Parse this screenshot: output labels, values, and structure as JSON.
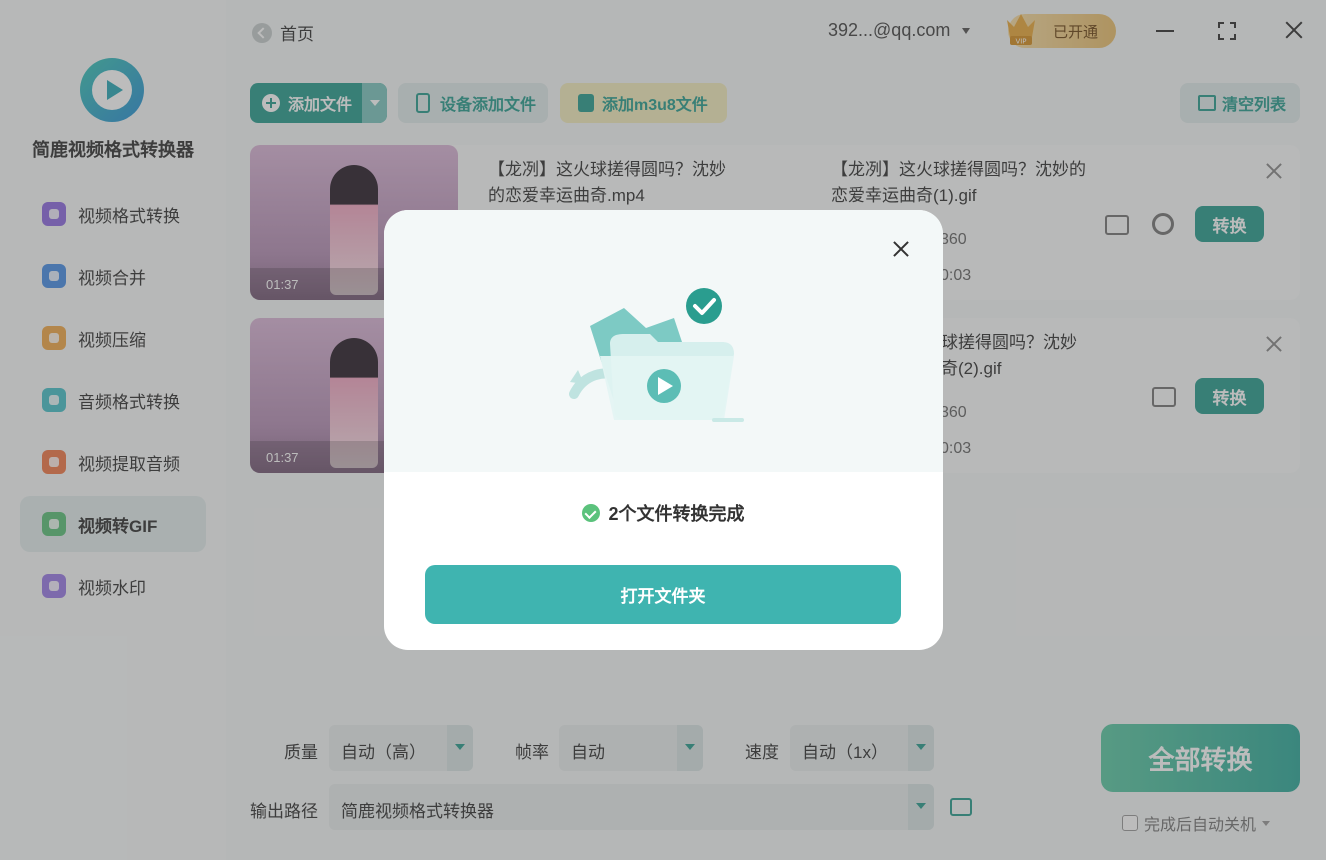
{
  "app": {
    "name": "简鹿视频格式转换器"
  },
  "sidebar": {
    "items": [
      {
        "label": "视频格式转换",
        "color": "#8e6be0"
      },
      {
        "label": "视频合并",
        "color": "#4a8fe6"
      },
      {
        "label": "视频压缩",
        "color": "#f0a94a"
      },
      {
        "label": "音频格式转换",
        "color": "#4ac0c8"
      },
      {
        "label": "视频提取音频",
        "color": "#f07a4a"
      },
      {
        "label": "视频转GIF",
        "color": "#5cc07a",
        "active": true
      },
      {
        "label": "视频水印",
        "color": "#9a7be6"
      }
    ]
  },
  "topbar": {
    "home": "首页",
    "account": "392...@qq.com",
    "vip_label": "已开通",
    "vip_badge": "VIP"
  },
  "toolbar": {
    "add_files": "添加文件",
    "device_add": "设备添加文件",
    "add_m3u8": "添加m3u8文件",
    "clear_list": "清空列表"
  },
  "files": [
    {
      "duration": "01:37",
      "source_name": "【龙冽】这火球搓得圆吗？沈妙的恋爱幸运曲奇.mp4",
      "output_name": "【龙冽】这火球搓得圆吗？沈妙的恋爱幸运曲奇(1).gif",
      "meta1": "360",
      "meta2": "0:03",
      "convert": "转换"
    },
    {
      "duration": "01:37",
      "output_name_partial_1": "球搓得圆吗？沈妙",
      "output_name_partial_2": "奇(2).gif",
      "meta1": "360",
      "meta2": "0:03",
      "convert": "转换"
    }
  ],
  "settings": {
    "quality_label": "质量",
    "quality_value": "自动（高）",
    "fps_label": "帧率",
    "fps_value": "自动",
    "speed_label": "速度",
    "speed_value": "自动（1x）",
    "output_label": "输出路径",
    "output_value": "简鹿视频格式转换器"
  },
  "actions": {
    "convert_all": "全部转换",
    "shutdown": "完成后自动关机"
  },
  "modal": {
    "status": "2个文件转换完成",
    "open_folder": "打开文件夹"
  },
  "colors": {
    "accent": "#2a9d8f",
    "modal_button": "#3fb4b0",
    "success": "#5bc27c"
  }
}
